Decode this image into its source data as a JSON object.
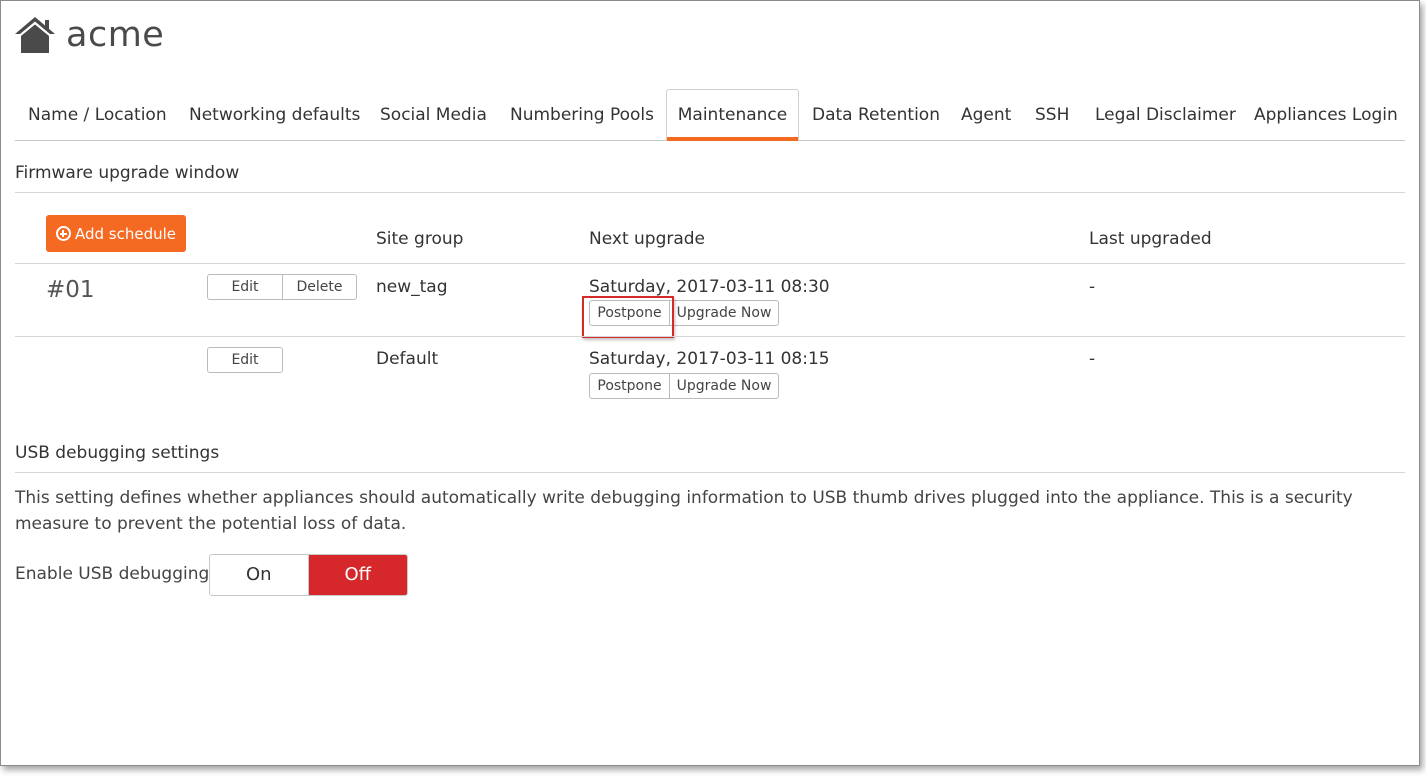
{
  "brand": {
    "name": "acme",
    "icon": "home-icon"
  },
  "tabs": [
    {
      "label": "Name / Location"
    },
    {
      "label": "Networking defaults"
    },
    {
      "label": "Social Media"
    },
    {
      "label": "Numbering Pools"
    },
    {
      "label": "Maintenance",
      "active": true
    },
    {
      "label": "Data Retention"
    },
    {
      "label": "Agent"
    },
    {
      "label": "SSH"
    },
    {
      "label": "Legal Disclaimer"
    },
    {
      "label": "Appliances Login"
    }
  ],
  "firmware": {
    "title": "Firmware upgrade window",
    "add_label": "Add schedule",
    "columns": {
      "site_group": "Site group",
      "next_upgrade": "Next upgrade",
      "last_upgraded": "Last upgraded"
    },
    "rows": [
      {
        "number": "#01",
        "edit_label": "Edit",
        "delete_label": "Delete",
        "site_group": "new_tag",
        "next_upgrade": "Saturday, 2017-03-11 08:30",
        "postpone_label": "Postpone",
        "upgrade_now_label": "Upgrade Now",
        "last_upgraded": "-"
      },
      {
        "number": "",
        "edit_label": "Edit",
        "site_group": "Default",
        "next_upgrade": "Saturday, 2017-03-11 08:15",
        "postpone_label": "Postpone",
        "upgrade_now_label": "Upgrade Now",
        "last_upgraded": "-"
      }
    ]
  },
  "usb": {
    "title": "USB debugging settings",
    "description": "This setting defines whether appliances should automatically write debugging information to USB thumb drives plugged into the appliance. This is a security measure to prevent the potential loss of data.",
    "toggle_label": "Enable USB debugging",
    "on_label": "On",
    "off_label": "Off",
    "selected": "Off"
  },
  "colors": {
    "accent": "#f46a22",
    "off_active": "#d6282a",
    "highlight": "#d42a2a"
  }
}
